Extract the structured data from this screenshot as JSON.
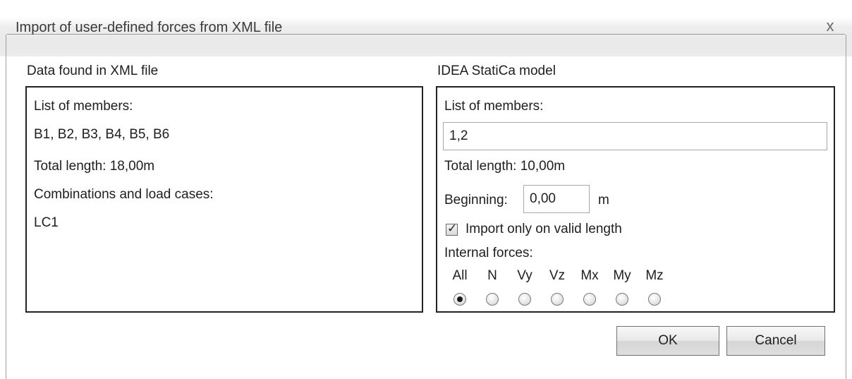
{
  "window": {
    "title": "Import of user-defined forces from XML file",
    "close_glyph": "x"
  },
  "xml": {
    "section_label": "Data found in XML file",
    "members_label": "List of members:",
    "members_value": "B1, B2, B3, B4, B5, B6",
    "total_length": "Total length:  18,00m",
    "combos_label": "Combinations and load cases:",
    "combos_value": "LC1"
  },
  "model": {
    "section_label": "IDEA StatiCa model",
    "members_label": "List of members:",
    "members_input": "1,2",
    "total_length": "Total length:  10,00m",
    "beginning_label": "Beginning:",
    "beginning_value": "0,00",
    "beginning_unit": "m",
    "import_valid_label": "Import only on valid length",
    "import_valid_checked": true,
    "internal_forces_label": "Internal forces:",
    "forces": [
      {
        "label": "All",
        "checked": true
      },
      {
        "label": "N",
        "checked": false
      },
      {
        "label": "Vy",
        "checked": false
      },
      {
        "label": "Vz",
        "checked": false
      },
      {
        "label": "Mx",
        "checked": false
      },
      {
        "label": "My",
        "checked": false
      },
      {
        "label": "Mz",
        "checked": false
      }
    ]
  },
  "buttons": {
    "ok": "OK",
    "cancel": "Cancel"
  }
}
